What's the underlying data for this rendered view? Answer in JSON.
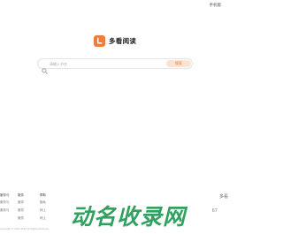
{
  "header": {
    "mobile_link": "手机版"
  },
  "logo": {
    "name": "多看阅读",
    "accent_color": "#f07c3a"
  },
  "search": {
    "placeholder": "请输入书名",
    "button_label": "搜索"
  },
  "footer": {
    "columns": [
      {
        "head": "服务与",
        "items": [
          "服务与",
          "服务与"
        ]
      },
      {
        "head": "服务",
        "items": [
          "服务",
          "服务",
          "服务"
        ]
      },
      {
        "head": "帮助",
        "items": [
          "隐私",
          "网上",
          "网上"
        ]
      }
    ],
    "brand": "多看",
    "qr_text": "67",
    "copyright": "Copyright © 2011-2022 All Rights Reserved."
  },
  "watermark": {
    "text": "动名收录网"
  }
}
